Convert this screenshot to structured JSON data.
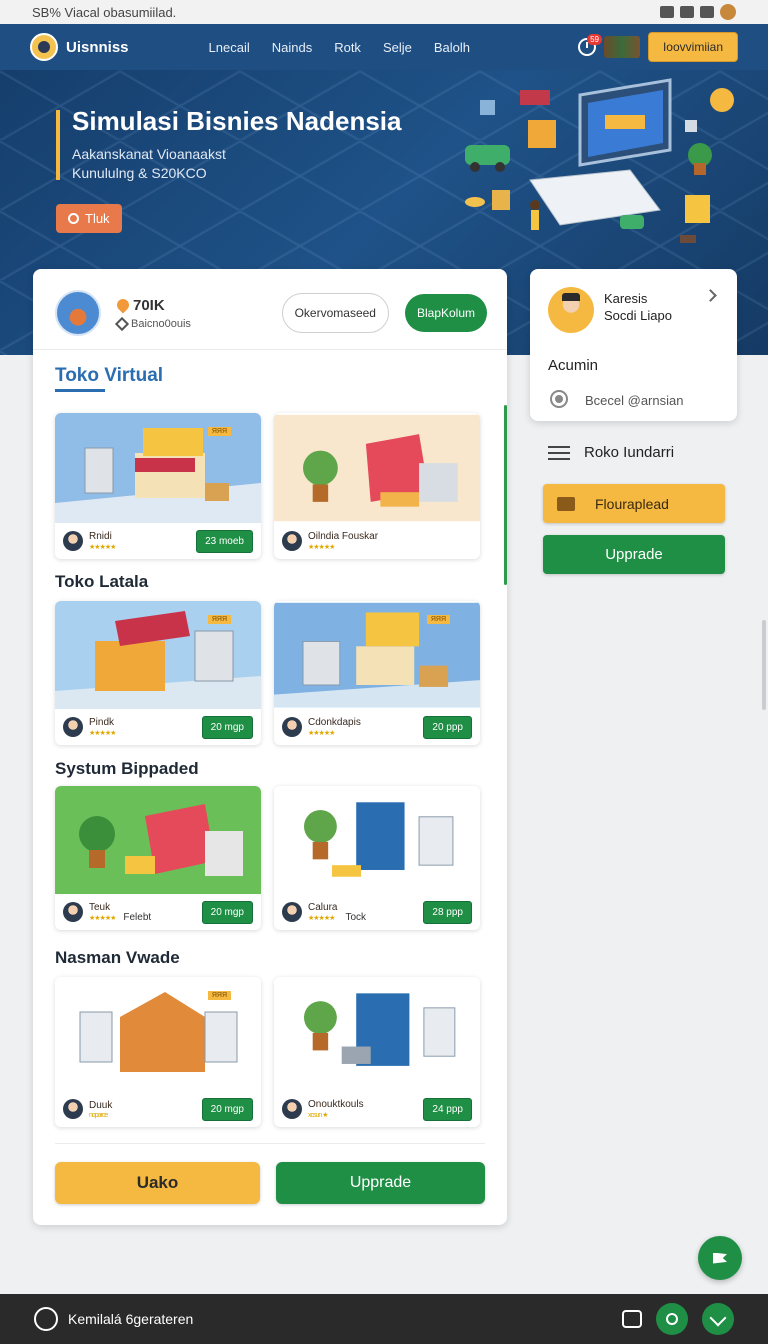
{
  "statusbar": {
    "left_text": "SB% Viacal obasumiilad."
  },
  "nav": {
    "brand": "Uisnniss",
    "links": [
      "Lnecail",
      "Nainds",
      "Rotk",
      "Selje",
      "Balolh"
    ],
    "notification_count": "59",
    "cta": "Ioovvimiian"
  },
  "hero": {
    "title": "Simulasi Bisnies Nadensia",
    "subtitle1": "Aakanskanat Vioanaakst",
    "subtitle2": "Kunululng & S20KCO",
    "button": "Tluk"
  },
  "profile": {
    "stat_main": "70IK",
    "stat_sub": "Baicno0ouis",
    "pill_outline": "Okervomaseed",
    "pill_green": "BlapKolum"
  },
  "sections": [
    {
      "title": "Toko Virtual"
    },
    {
      "title": "Toko Latala"
    },
    {
      "title": "Systum Bippaded"
    },
    {
      "title": "Nasman Vwade"
    }
  ],
  "tiles": [
    {
      "name": "Rnidi",
      "stars": "★★★★★",
      "extra": "",
      "price": "23 moeb",
      "tag": "ЯЯЯ"
    },
    {
      "name": "Oilndia Fouskar",
      "stars": "★★★★★",
      "extra": "",
      "price": "",
      "tag": ""
    },
    {
      "name": "Pindk",
      "stars": "★★★★★",
      "extra": "",
      "price": "20 mgp",
      "tag": "ЯЯЯ"
    },
    {
      "name": "Cdonkdapis",
      "stars": "★★★★★",
      "extra": "",
      "price": "20 ppp",
      "tag": "ЯЯЯ"
    },
    {
      "name": "Teuk",
      "stars": "★★★★★",
      "extra": "Felebt",
      "price": "20 mgp",
      "tag": ""
    },
    {
      "name": "Calura",
      "stars": "★★★★★",
      "extra": "Tock",
      "price": "28 ppp",
      "tag": ""
    },
    {
      "name": "Duuk",
      "stars": "noparce",
      "extra": "",
      "price": "20 mgp",
      "tag": "ЯЯЯ"
    },
    {
      "name": "Onouktkouls",
      "stars": "xcsun ★",
      "extra": "",
      "price": "24 ppp",
      "tag": ""
    }
  ],
  "card_buttons": {
    "yellow": "Uako",
    "green": "Upprade"
  },
  "right_panel": {
    "name1": "Karesis",
    "name2": "Socdi Liapo",
    "role": "Acumin",
    "radio_label": "Bcecel @arnsian",
    "list_item": "Roko Iundarri",
    "btn_yellow": "Flouraplead",
    "btn_green": "Upprade"
  },
  "bottombar": {
    "label": "Kemilalá 6gerateren"
  },
  "colors": {
    "primary": "#1f4e82",
    "green": "#1f8f45",
    "yellow": "#f5b941"
  }
}
